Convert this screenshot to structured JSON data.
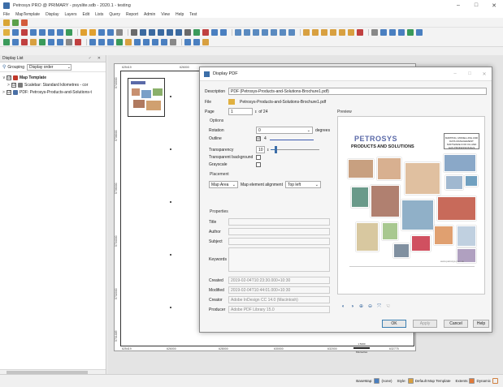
{
  "app": {
    "title": "Petrosys PRO @ PRIMARY - psyslite.sdb - 2020.1 - testing",
    "window_buttons": [
      "–",
      "□",
      "✕"
    ]
  },
  "menu": [
    "File",
    "MapTemplate",
    "Display",
    "Layers",
    "Edit",
    "Lists",
    "Query",
    "Report",
    "Admin",
    "View",
    "Help",
    "Test"
  ],
  "left_panel": {
    "title": "Display List",
    "header_buttons": "♂ ✕",
    "grouping_label": "Grouping",
    "grouping_value": "Display order",
    "tree": [
      {
        "label": "Map Template",
        "bold": true,
        "expander": "∨",
        "checked": "☑",
        "color": "#c0392b"
      },
      {
        "label": "Scalebar: Standard kilometres - cor",
        "bold": false,
        "expander": ">",
        "checked": "☑",
        "color": "#7a7a7a"
      },
      {
        "label": "PDF: Petrosys-Products-and-Solutions-t",
        "bold": false,
        "expander": ">",
        "checked": "☑",
        "color": "#4a6fa5"
      }
    ]
  },
  "map": {
    "top_ticks": [
      "625419",
      "626000"
    ],
    "bottom_ticks": [
      "625419",
      "626000",
      "628000",
      "630000",
      "632000",
      "632775"
    ],
    "left_ticks": [
      "5740000",
      "5738000",
      "5736000",
      "5734000",
      "5732000",
      "5731689"
    ],
    "scalebar_label": "Kilometres",
    "scalebar_ratio": "1:5000"
  },
  "dialog": {
    "title": "Display PDF",
    "title_buttons": [
      "–",
      "□",
      "✕"
    ],
    "description_label": "Description",
    "description_value": "PDF (Petrosys-Products-and-Solutions-Brochure1.pdf)",
    "file_label": "File",
    "file_value": "Petrosys-Products-and-Solutions-Brochure1.pdf",
    "page_label": "Page",
    "page_value": "1",
    "page_of": "of 24",
    "options_label": "Options",
    "rotation_label": "Rotation",
    "rotation_value": "0",
    "rotation_unit": "degrees",
    "outline_label": "Outline",
    "outline_checked": "☑",
    "outline_value": "4",
    "transparency_label": "Transparency",
    "transparency_value": "10",
    "transparency_fraction": 0.1,
    "transparent_bg_label": "Transparent background",
    "grayscale_label": "Grayscale",
    "placement_label": "Placement",
    "placement_value": "Map Area",
    "alignment_label": "Map element alignment",
    "alignment_value": "Top left",
    "properties_label": "Properties",
    "title_label": "Title",
    "author_label": "Author",
    "subject_label": "Subject",
    "keywords_label": "Keywords",
    "created_label": "Created",
    "created_value": "2019-02-04T10:23:30.000+10:30",
    "modified_label": "Modified",
    "modified_value": "2019-02-04T10:44:01.000+10:30",
    "creator_label": "Creator",
    "creator_value": "Adobe InDesign CC 14.0 (Macintosh)",
    "producer_label": "Producer",
    "producer_value": "Adobe PDF Library 15.0",
    "preview_label": "Preview",
    "buttons": {
      "ok": "OK",
      "apply": "Apply",
      "cancel": "Cancel",
      "help": "Help"
    }
  },
  "brochure": {
    "logo": "PETROSYS",
    "subtitle": "PRODUCTS AND SOLUTIONS",
    "tagline": "MAPPING, MODELLING AND DATA MANAGEMENT SOFTWARE FOR OIL AND GAS PROFESSIONALS",
    "website": "www.petrosys.com.au"
  },
  "status": {
    "basemap_label": "BaseMap:",
    "basemap_value": "(none)",
    "style_label": "Style:",
    "style_value": "Default Map Template",
    "extents_label": "Extents",
    "dynamic_label": "Dynamic"
  }
}
